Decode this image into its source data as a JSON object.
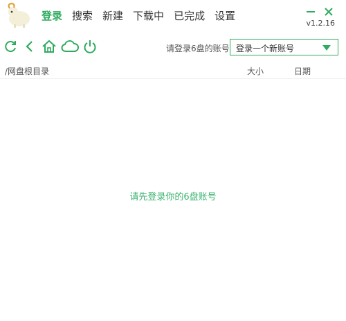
{
  "app": {
    "logo_icon": "sheep-logo-icon",
    "version": "v1.2.16",
    "accent_color": "#2eab5f"
  },
  "nav": {
    "items": [
      {
        "label": "登录",
        "active": true
      },
      {
        "label": "搜索",
        "active": false
      },
      {
        "label": "新建",
        "active": false
      },
      {
        "label": "下载中",
        "active": false
      },
      {
        "label": "已完成",
        "active": false
      },
      {
        "label": "设置",
        "active": false
      }
    ]
  },
  "window": {
    "minimize_icon": "minimize-icon",
    "close_icon": "close-icon"
  },
  "toolbar": {
    "icons": [
      "refresh-icon",
      "back-icon",
      "home-icon",
      "cloud-icon",
      "power-icon"
    ],
    "account_label": "请登录6盘的账号",
    "account_select_value": "登录一个新账号"
  },
  "file_list": {
    "path": "/网盘根目录",
    "col_size": "大小",
    "col_date": "日期",
    "empty_message": "请先登录你的6盘账号"
  }
}
